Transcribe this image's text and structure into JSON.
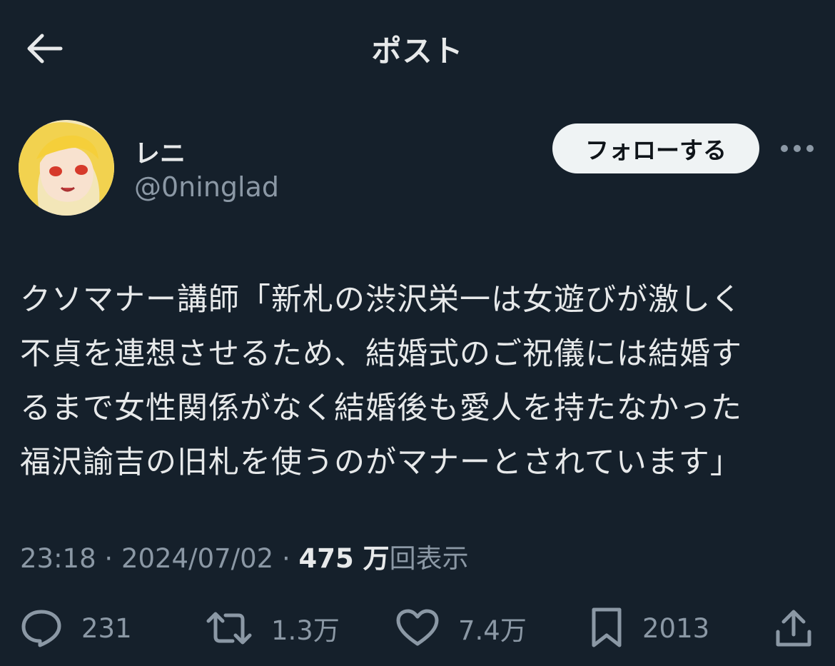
{
  "header": {
    "title": "ポスト",
    "back_icon": "arrow-left-icon"
  },
  "author": {
    "display_name": "レニ",
    "handle": "@0ninglad",
    "follow_label": "フォローする",
    "more_icon": "more-horizontal-icon"
  },
  "post": {
    "lines": [
      "クソマナー講師「新札の渋沢栄一は女遊びが激しく",
      "不貞を連想させるため、結婚式のご祝儀には結婚す",
      "るまで女性関係がなく結婚後も愛人を持たなかった",
      "福沢諭吉の旧札を使うのがマナーとされています」"
    ],
    "time": "23:18",
    "date": "2024/07/02",
    "separator": " · ",
    "views_count": "475 万",
    "views_label": "回表示"
  },
  "actions": {
    "replies": "231",
    "reposts": "1.3万",
    "likes": "7.4万",
    "bookmarks": "2013"
  },
  "colors": {
    "background": "#15202b",
    "text": "#e7e9ea",
    "secondary": "#8b98a5",
    "follow_bg": "#eff3f4"
  }
}
